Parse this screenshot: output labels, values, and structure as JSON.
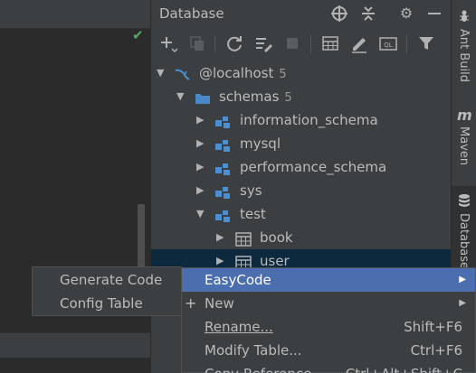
{
  "panel": {
    "title": "Database"
  },
  "tree": {
    "host": {
      "label": "@localhost",
      "count": "5"
    },
    "schemas": {
      "label": "schemas",
      "count": "5"
    },
    "items": [
      {
        "label": "information_schema"
      },
      {
        "label": "mysql"
      },
      {
        "label": "performance_schema"
      },
      {
        "label": "sys"
      },
      {
        "label": "test"
      }
    ],
    "tables": [
      {
        "label": "book"
      },
      {
        "label": "user"
      }
    ]
  },
  "stripe": {
    "ant_build": "Ant Build",
    "maven": "Maven",
    "database": "Database",
    "maven_glyph": "m"
  },
  "context_menu": {
    "items": [
      {
        "label": "EasyCode",
        "shortcut": ""
      },
      {
        "label": "New",
        "shortcut": ""
      },
      {
        "label": "Rename...",
        "shortcut": "Shift+F6"
      },
      {
        "label": "Modify Table...",
        "shortcut": "Ctrl+F6"
      },
      {
        "label": "Copy Reference",
        "shortcut": "Ctrl+Alt+Shift+C"
      }
    ]
  },
  "submenu": {
    "items": [
      {
        "label": "Generate Code"
      },
      {
        "label": "Config Table"
      }
    ]
  },
  "icons": {
    "schema_color": "#4a8fd1",
    "folder_color": "#4a88c7",
    "highlight_color": "#4b6eaf",
    "selected_row_color": "#0d293e",
    "ok_color": "#59a869"
  }
}
